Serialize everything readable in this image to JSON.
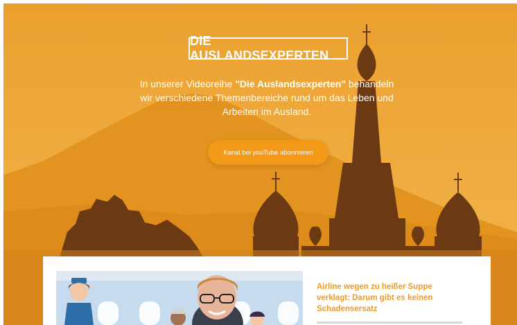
{
  "hero": {
    "title": "DIE AUSLANDSEXPERTEN",
    "intro_pre": "In unserer Videoreihe ",
    "intro_bold": "\"Die Auslandsexperten\"",
    "intro_post": " behandeln wir verschiedene Themenbereiche rund um das Leben und Arbeiten im Ausland.",
    "cta_label": "Kanal bei youTube abonnieren",
    "background_illustration": "mountain-and-onion-dome-silhouette"
  },
  "article": {
    "title": "Airline wegen zu heißer Suppe verklagt: Darum gibt es keinen Schadensersatz",
    "thumbnail": "airplane-cabin-illustration-with-presenter"
  },
  "colors": {
    "hero_orange": "#eea83a",
    "silhouette_brown": "#6b3a12",
    "accent": "#f29a17",
    "article_title": "#f09a22"
  }
}
